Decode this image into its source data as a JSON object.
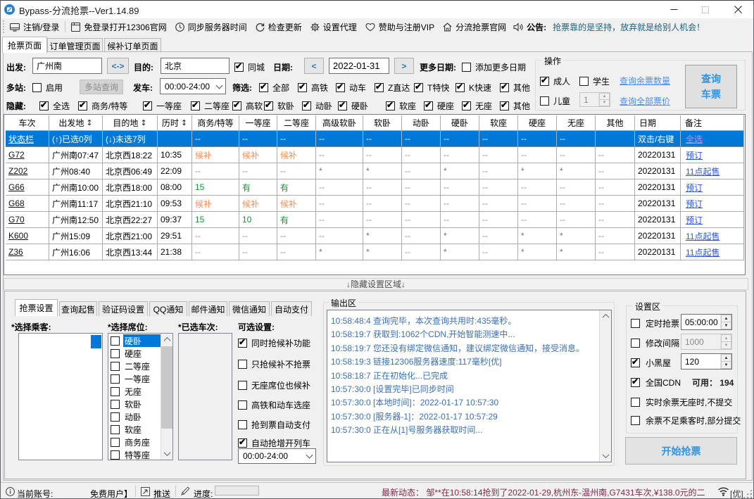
{
  "window": {
    "title": "Bypass-分流抢票--Ver1.14.89",
    "controls": {
      "minimize": "—",
      "maximize": "□",
      "close": "✕"
    }
  },
  "toolbar": {
    "items": [
      {
        "icon": "monitor-icon",
        "label": "注销/登录"
      },
      {
        "icon": "window-icon",
        "label": "免登录打开12306官网"
      },
      {
        "icon": "clock-icon",
        "label": "同步服务器时间"
      },
      {
        "icon": "refresh-icon",
        "label": "检查更新"
      },
      {
        "icon": "gear-icon",
        "label": "设置代理"
      },
      {
        "icon": "heart-icon",
        "label": "赞助与注册VIP"
      },
      {
        "icon": "home-icon",
        "label": "分流抢票官网"
      }
    ],
    "announce_icon": "speaker-icon",
    "announce_label": "公告:",
    "announcement": "抢票靠的是坚持，放弃就是给别人机会！"
  },
  "main_tabs": [
    {
      "label": "抢票页面",
      "active": true
    },
    {
      "label": "订单管理页面",
      "active": false
    },
    {
      "label": "候补订单页面",
      "active": false
    }
  ],
  "query": {
    "dep_label": "出发:",
    "dep_value": "广州南",
    "swap_label": "<->",
    "dest_label": "目的:",
    "dest_value": "北京",
    "same_city": {
      "label": "同城",
      "checked": true
    },
    "date_label": "日期:",
    "prev_label": "<",
    "date_value": "2022-01-31",
    "next_label": ">",
    "more_label": "更多日期:",
    "add_more": {
      "label": "添加更多日期",
      "checked": false
    },
    "multi_label": "多站:",
    "multi_enable": {
      "label": "启用",
      "checked": false
    },
    "multi_btn": "多站查询",
    "depart_label": "发车:",
    "depart_range": "00:00-24:00",
    "filter_label": "筛选:",
    "filters": [
      {
        "label": "全部",
        "checked": true
      },
      {
        "label": "高铁",
        "checked": true
      },
      {
        "label": "动车",
        "checked": true
      },
      {
        "label": "Z直达",
        "checked": true
      },
      {
        "label": "T特快",
        "checked": true
      },
      {
        "label": "K快速",
        "checked": true
      },
      {
        "label": "其他",
        "checked": true
      }
    ],
    "hide_label": "隐藏:",
    "hides": [
      {
        "label": "全选",
        "checked": true
      },
      {
        "label": "商务/特等",
        "checked": true
      },
      {
        "label": "一等座",
        "checked": true
      },
      {
        "label": "二等座",
        "checked": true
      },
      {
        "label": "高软",
        "checked": true
      },
      {
        "label": "软卧",
        "checked": true
      },
      {
        "label": "动卧",
        "checked": true
      },
      {
        "label": "硬卧",
        "checked": true
      },
      {
        "label": "软座",
        "checked": true
      },
      {
        "label": "硬座",
        "checked": true
      },
      {
        "label": "无座",
        "checked": true
      },
      {
        "label": "其他",
        "checked": true
      }
    ]
  },
  "operate": {
    "title": "操作",
    "adult": {
      "label": "成人",
      "checked": true
    },
    "student": {
      "label": "学生",
      "checked": false
    },
    "child": {
      "label": "儿童",
      "checked": false
    },
    "child_count": "1",
    "link_remaining": "查询余票数量",
    "link_price": "查询全部票价",
    "query_btn_line1": "查询",
    "query_btn_line2": "车票"
  },
  "table": {
    "columns": [
      "车次",
      "出发地",
      "目的地",
      "历时",
      "商务/特等",
      "一等座",
      "二等座",
      "高级软卧",
      "软卧",
      "动卧",
      "硬卧",
      "软座",
      "硬座",
      "无座",
      "其他",
      "日期",
      "备注"
    ],
    "sort_glyph": "↕",
    "sortable_columns": [
      1,
      2,
      3
    ],
    "rows": [
      {
        "selected": true,
        "cells": [
          "状态栏",
          "(↑)已选0列",
          "(↓)未选7列",
          "",
          "--",
          "--",
          "--",
          "--",
          "--",
          "--",
          "--",
          "--",
          "--",
          "--",
          "",
          "双击/右键",
          "全选"
        ]
      },
      {
        "cells": [
          "G72",
          "广州南07:47",
          "北京西18:22",
          "10:35",
          "候补",
          "候补",
          "候补",
          "--",
          "--",
          "--",
          "--",
          "--",
          "--",
          "--",
          "--",
          "20220131",
          "预订"
        ]
      },
      {
        "cells": [
          "Z202",
          "广州08:40",
          "北京西06:49",
          "22:09",
          "--",
          "--",
          "--",
          "*",
          "*",
          "--",
          "*",
          "--",
          "*",
          "*",
          "--",
          "20220131",
          "11点起售"
        ]
      },
      {
        "cells": [
          "G66",
          "广州南10:00",
          "北京西18:00",
          "08:00",
          "15",
          "有",
          "有",
          "--",
          "--",
          "--",
          "--",
          "--",
          "--",
          "--",
          "--",
          "20220131",
          "预订"
        ]
      },
      {
        "cells": [
          "G68",
          "广州南11:17",
          "北京西21:10",
          "09:53",
          "候补",
          "候补",
          "候补",
          "--",
          "--",
          "--",
          "--",
          "--",
          "--",
          "--",
          "--",
          "20220131",
          "预订"
        ]
      },
      {
        "cells": [
          "G70",
          "广州南12:50",
          "北京西22:27",
          "09:37",
          "15",
          "10",
          "有",
          "--",
          "--",
          "--",
          "--",
          "--",
          "--",
          "--",
          "--",
          "20220131",
          "预订"
        ]
      },
      {
        "cells": [
          "K600",
          "广州15:09",
          "北京西21:00",
          "29:51",
          "--",
          "--",
          "--",
          "--",
          "*",
          "--",
          "*",
          "--",
          "*",
          "*",
          "--",
          "20220131",
          "11点起售"
        ]
      },
      {
        "cells": [
          "Z36",
          "广州16:06",
          "北京西13:44",
          "21:38",
          "--",
          "--",
          "--",
          "*",
          "*",
          "--",
          "*",
          "--",
          "*",
          "*",
          "--",
          "20220131",
          "11点起售"
        ]
      }
    ]
  },
  "splitter_label": "↓隐藏设置区域↓",
  "grab_panel": {
    "tabs": [
      {
        "label": "抢票设置",
        "active": true
      },
      {
        "label": "查询起售",
        "active": false
      },
      {
        "label": "验证码设置",
        "active": false
      },
      {
        "label": "QQ通知",
        "active": false
      },
      {
        "label": "邮件通知",
        "active": false
      },
      {
        "label": "微信通知",
        "active": false
      },
      {
        "label": "自动支付",
        "active": false
      }
    ],
    "passengers_label": "*选择乘客:",
    "seats_label": "*选择席位:",
    "trains_label": "*已选车次:",
    "options_label": "可选设置:",
    "seats": [
      {
        "label": "硬卧",
        "checked": false,
        "selected": true
      },
      {
        "label": "硬座",
        "checked": false
      },
      {
        "label": "二等座",
        "checked": false
      },
      {
        "label": "一等座",
        "checked": false
      },
      {
        "label": "无座",
        "checked": false
      },
      {
        "label": "软卧",
        "checked": false
      },
      {
        "label": "动卧",
        "checked": false
      },
      {
        "label": "软座",
        "checked": false
      },
      {
        "label": "商务座",
        "checked": false
      },
      {
        "label": "特等座",
        "checked": false
      }
    ],
    "options": [
      {
        "label": "同时抢候补功能",
        "checked": true
      },
      {
        "label": "只抢候补不抢票",
        "checked": false
      },
      {
        "label": "无座席位也候补",
        "checked": false
      },
      {
        "label": "高铁和动车选座",
        "checked": false
      },
      {
        "label": "抢到票自动支付",
        "checked": false
      },
      {
        "label": "自动抢增开列车",
        "checked": true
      }
    ],
    "time_range": "00:00-24:00"
  },
  "output": {
    "title": "输出区",
    "lines": [
      "10:58:48:4  查询完毕，本次查询共用时:435毫秒。",
      "10:58:19:7  获取到:1062个CDN,开始智能测速中...",
      "10:58:19:7  您还没有绑定微信通知，建议绑定微信通知，接受消息。",
      "10:58:19:3  链接12306服务器速度:117毫秒[优]",
      "10:58:18:7  正在初始化...已完成",
      "10:57:30:0  [设置完毕]已同步时间",
      "10:57:30:0  [本地时间]：2022-01-17 10:57:30",
      "10:57:30:0  [服务器-1]：2022-01-17 10:57:29",
      "10:57:30:0  正在从[1]号服务器获取时间..."
    ]
  },
  "config": {
    "title": "设置区",
    "items": [
      {
        "label": "定时抢票",
        "checked": false,
        "value": "05:00:00",
        "disabled": false
      },
      {
        "label": "修改间隔",
        "checked": false,
        "value": "1000",
        "disabled": true
      },
      {
        "label": "小黑屋",
        "checked": true,
        "value": "120",
        "disabled": false
      },
      {
        "label": "全国CDN",
        "checked": true,
        "suffix": "可用： 194"
      },
      {
        "label": "实时余票无座时,不提交",
        "checked": false
      },
      {
        "label": "余票不足乘客时,部分提交",
        "checked": false
      }
    ],
    "start_btn": "开始抢票"
  },
  "statusbar": {
    "info_icon": "info-icon",
    "account_label": "当前账号:",
    "account_value": "免费用户】",
    "push_icon": "push-icon",
    "push_label": "推送",
    "pencil_icon": "pencil-icon",
    "progress_label": "进度:",
    "news_label": "最新动态：",
    "news": "邹**在10:58:14抢到了2022-01-29,杭州东-温州南,G7431车次,¥138.0元的二",
    "wifi_icon": "wifi-icon",
    "quality": "[优]"
  },
  "colors": {
    "selection_blue": "#0078d7",
    "link_royal": "#2d55dd",
    "link_light": "#4a90f0",
    "waitlist_orange": "#ff8c50",
    "available_green": "#009e3c",
    "log_blue": "#3a70b8",
    "announce_teal": "#19607f",
    "news_maroon": "#7d2b47",
    "button_blue": "#2b95e9"
  }
}
